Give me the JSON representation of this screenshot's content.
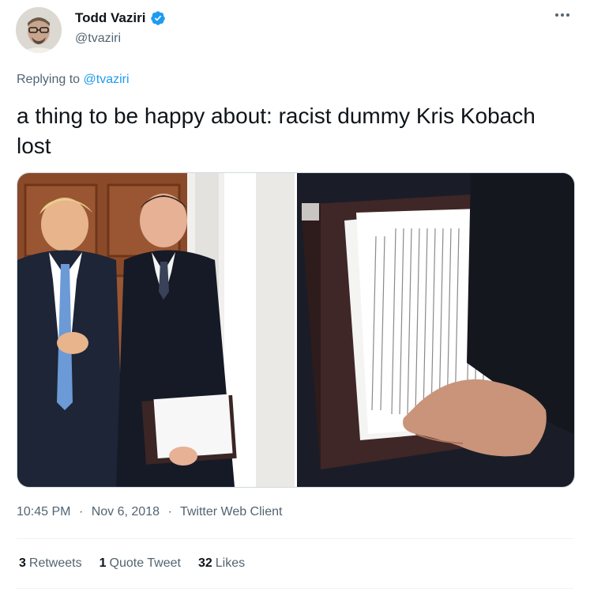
{
  "author": {
    "display_name": "Todd Vaziri",
    "handle": "@tvaziri",
    "verified": true
  },
  "reply": {
    "prefix": "Replying to",
    "target": "@tvaziri"
  },
  "tweet": {
    "text": "a thing to be happy about: racist dummy Kris Kobach lost"
  },
  "media": {
    "count": 2
  },
  "meta": {
    "time": "10:45 PM",
    "date": "Nov 6, 2018",
    "separator": "·",
    "client": "Twitter Web Client"
  },
  "stats": {
    "retweets": {
      "count": "3",
      "label": "Retweets"
    },
    "quote_tweets": {
      "count": "1",
      "label": "Quote Tweet"
    },
    "likes": {
      "count": "32",
      "label": "Likes"
    }
  },
  "colors": {
    "link": "#1d9bf0",
    "secondary_text": "#536471",
    "primary_text": "#0f1419"
  }
}
